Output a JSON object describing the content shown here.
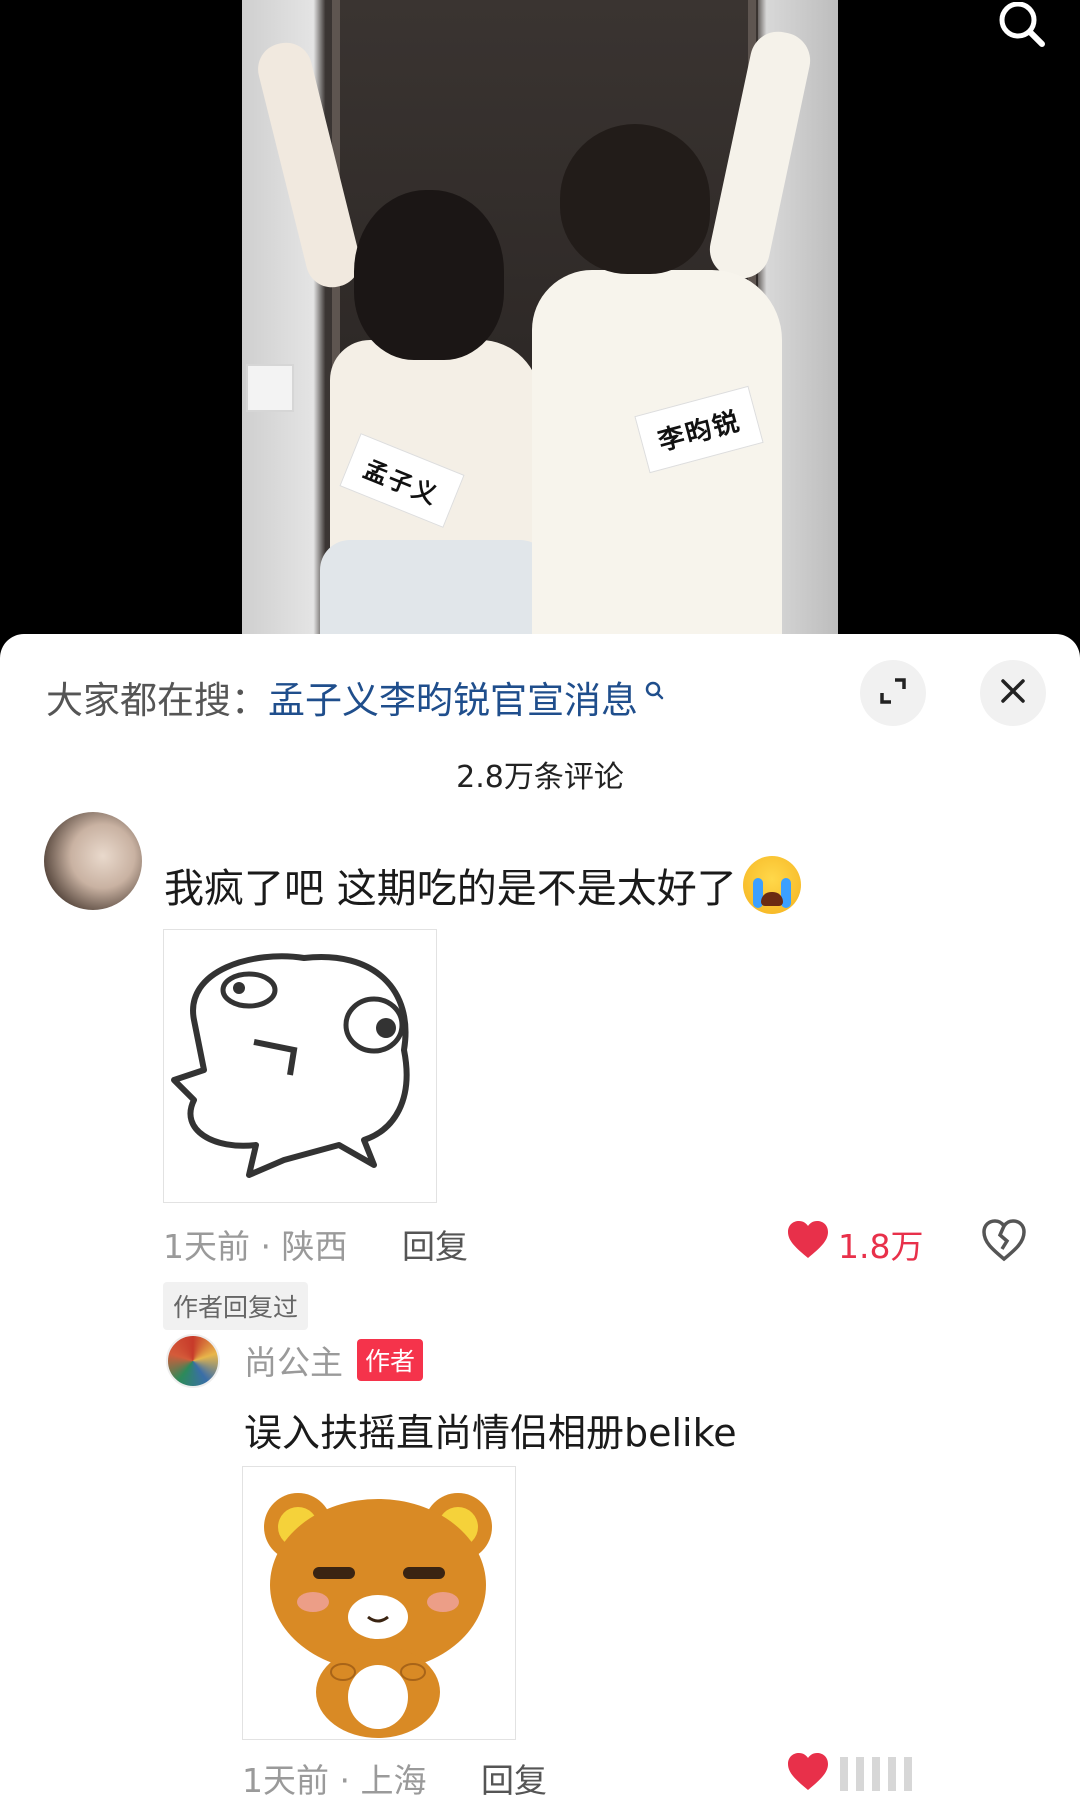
{
  "hot_search": {
    "prefix": "大家都在搜：",
    "query": "孟子义李昀锐官宣消息"
  },
  "photo": {
    "tag_left": "孟子义",
    "tag_right": "李昀锐"
  },
  "comments_count": "2.8万条评论",
  "comments": [
    {
      "text": "我疯了吧 这期吃的是不是太好了",
      "emoji": "crying-face-icon",
      "time": "1天前",
      "location": "陕西",
      "reply_label": "回复",
      "likes": "1.8万",
      "author_replied_label": "作者回复过"
    },
    {
      "username": "尚公主",
      "badge": "作者",
      "text": "误入扶摇直尚情侣相册belike",
      "time": "1天前",
      "location": "上海",
      "reply_label": "回复"
    }
  ],
  "colors": {
    "link_blue": "#1f4e8c",
    "like_red": "#e8304a",
    "badge_red": "#f5334b"
  }
}
